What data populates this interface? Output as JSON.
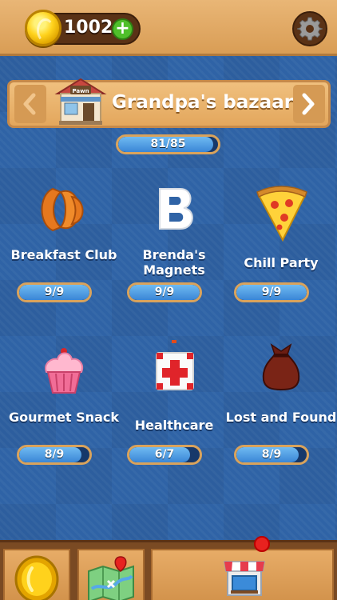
{
  "currency": {
    "coins": "1002"
  },
  "location": {
    "title": "Grandpa's bazaar",
    "shop_sign": "Pawn",
    "progress": "81/85",
    "progress_fraction": 0.953
  },
  "collections": [
    {
      "label": "Breakfast Club",
      "icon": "croissant-icon",
      "progress": "9/9",
      "fraction": 1.0
    },
    {
      "label": "Brenda's Magnets",
      "icon": "letter-b-magnet-icon",
      "progress": "9/9",
      "fraction": 1.0
    },
    {
      "label": "Chill Party",
      "icon": "pizza-slice-icon",
      "progress": "9/9",
      "fraction": 1.0
    },
    {
      "label": "Gourmet Snack",
      "icon": "cupcake-icon",
      "progress": "8/9",
      "fraction": 0.889
    },
    {
      "label": "Healthcare",
      "icon": "first-aid-kit-icon",
      "progress": "6/7",
      "fraction": 0.857
    },
    {
      "label": "Lost and Found",
      "icon": "sack-icon",
      "progress": "8/9",
      "fraction": 0.889
    }
  ],
  "colors": {
    "accent": "#e3a75d",
    "background": "#2f63a6",
    "bar_fill": "#3a86d6",
    "notification": "#e8221f"
  }
}
